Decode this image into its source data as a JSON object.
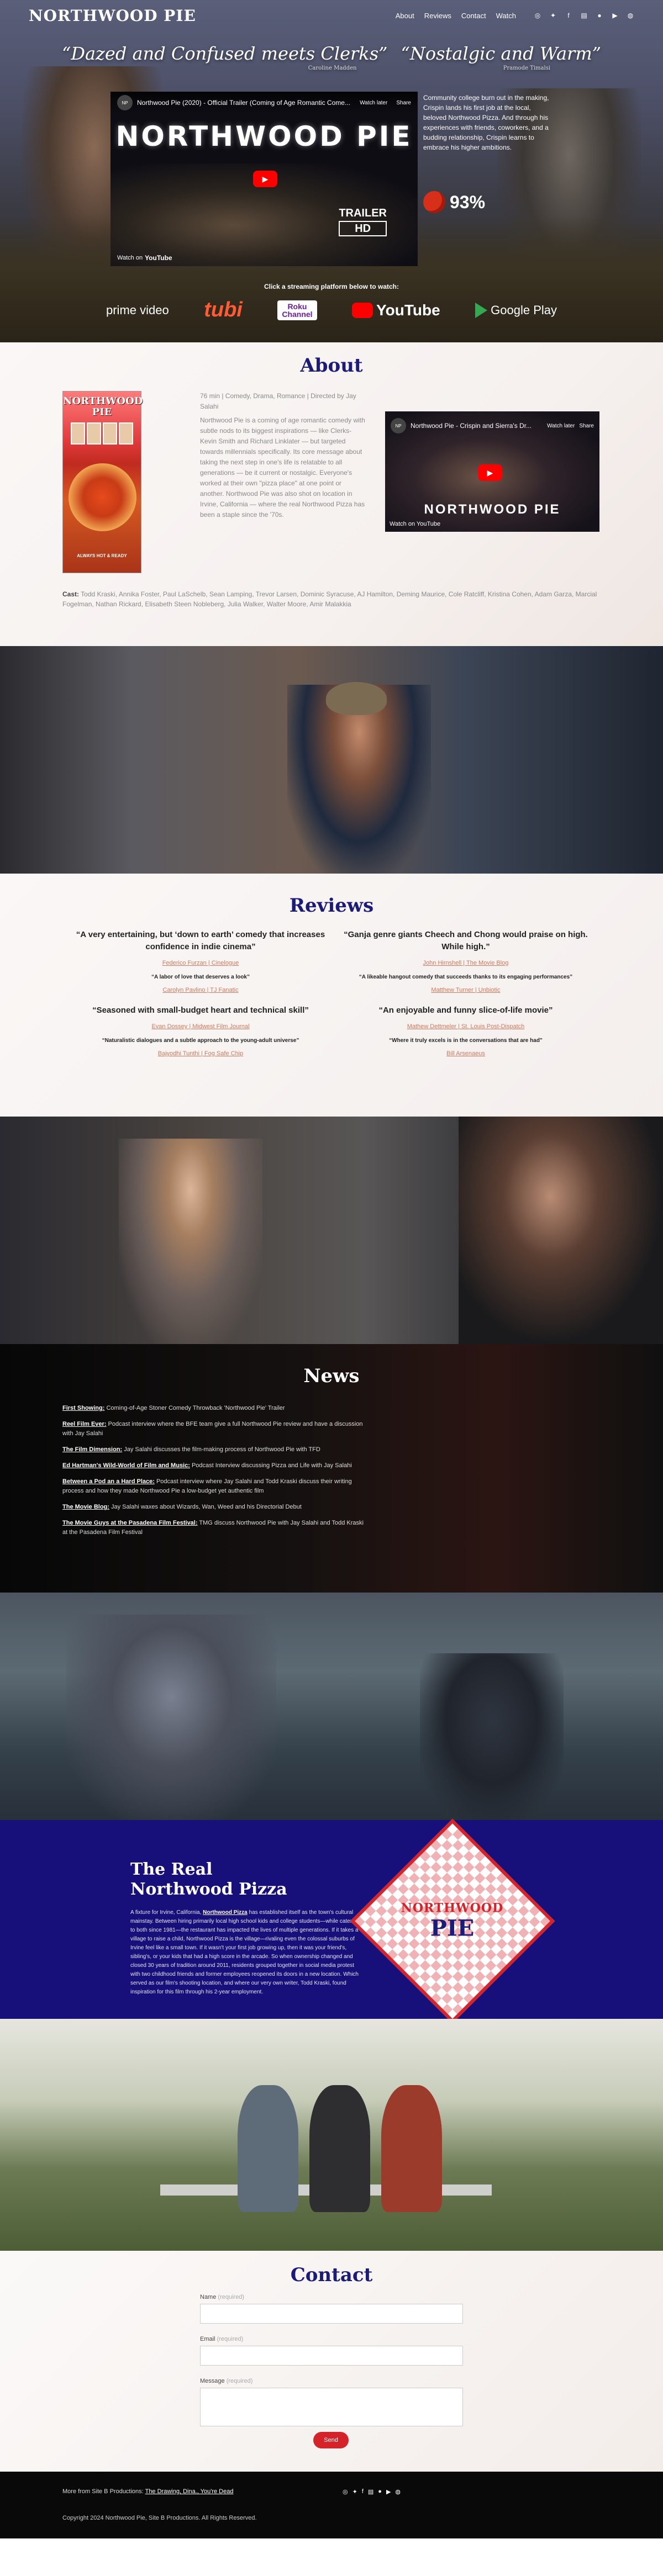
{
  "header": {
    "logo": "NORTHWOOD PIE",
    "nav": [
      "About",
      "Reviews",
      "Contact",
      "Watch"
    ],
    "social_icons": [
      "instagram-icon",
      "twitter-icon",
      "facebook-icon",
      "imdb-icon",
      "letterboxd-icon",
      "youtube-icon",
      "globe-icon"
    ],
    "social_glyphs": [
      "◎",
      "✦",
      "f",
      "▤",
      "●",
      "▶",
      "◍"
    ]
  },
  "hero": {
    "quote1": "“Dazed and Confused meets Clerks”",
    "quote1_source": "Caroline Madden",
    "quote2": "“Nostalgic and Warm”",
    "quote2_source": "Pramode Timalsi",
    "player": {
      "channel": "NP",
      "title": "Northwood Pie (2020) - Official Trailer (Coming of Age Romantic Come...",
      "watch_later": "Watch later",
      "share": "Share",
      "big_title": "NORTHWOOD PIE",
      "trailer": "TRAILER",
      "hd": "HD",
      "watch_on": "Watch on",
      "youtube": "YouTube"
    },
    "synopsis": "Community college burn out in the making, Crispin lands his first job at the local, beloved Northwood Pizza. And through his experiences with friends, coworkers, and a budding relationship, Crispin learns to embrace his higher ambitions.",
    "tomato_score": "93%",
    "stream_label": "Click a streaming platform below to watch:",
    "platforms": {
      "prime": "prime video",
      "tubi": "tubi",
      "roku1": "Roku",
      "roku2": "Channel",
      "youtube": "YouTube",
      "google": "Google Play"
    }
  },
  "about": {
    "heading": "About",
    "poster_title": "NORTHWOOD PIE",
    "poster_tag": "ALWAYS HOT & READY",
    "meta": "76 min | Comedy, Drama, Romance | Directed by Jay Salahi",
    "body": "Northwood Pie is a coming of age romantic comedy with subtle nods to its biggest inspirations — like Clerks-Kevin Smith and Richard Linklater — but targeted towards millennials specifically. Its core message about taking the next step in one's life is relatable to all generations — be it current or nostalgic. Everyone's worked at their own \"pizza place\" at one point or another. Northwood Pie was also shot on location in Irvine, California — where the real Northwood Pizza has been a staple since the '70s.",
    "player": {
      "channel": "NP",
      "title": "Northwood Pie - Crispin and Sierra's Dr...",
      "watch_later": "Watch later",
      "share": "Share",
      "big_title": "NORTHWOOD PIE",
      "watch_on": "Watch on YouTube"
    },
    "cast_label": "Cast:",
    "cast": "Todd Kraski, Annika Foster, Paul LaSchelb, Sean Lamping, Trevor Larsen, Dominic Syracuse, AJ Hamilton, Deming Maurice, Cole Ratcliff, Kristina Cohen, Adam Garza, Marcial Fogelman, Nathan Rickard, Elisabeth Steen Nobleberg, Julia Walker, Walter Moore, Amir Malakkia"
  },
  "reviews": {
    "heading": "Reviews",
    "left": [
      {
        "headline": "“A very entertaining, but ‘down to earth’ comedy that increases confidence in indie cinema”",
        "source": "Federico Furzan | Cinelogue"
      },
      {
        "headline": "“A labor of love that deserves a look”",
        "source": "Carolyn Pavlino | TJ Fanatic",
        "small": true
      },
      {
        "headline": "“Seasoned with small-budget heart and technical skill”",
        "source": "Evan Dossey | Midwest Film Journal"
      },
      {
        "headline": "“Naturalistic dialogues and a subtle approach to the young-adult universe”",
        "source": "Bajyodhi Tunthi | Fog Safe Chip",
        "small": true
      }
    ],
    "right": [
      {
        "headline": "“Ganja genre giants Cheech and Chong would praise on high. While high.”",
        "source": "John Hirnshell | The Movie Blog"
      },
      {
        "headline": "“A likeable hangout comedy that succeeds thanks to its engaging performances”",
        "source": "Matthew Turner | Unbiotic",
        "small": true
      },
      {
        "headline": "“An enjoyable and funny slice-of-life movie”",
        "source": "Mathew Dettmeler | St. Louis Post-Dispatch"
      },
      {
        "headline": "“Where it truly excels is in the conversations that are had”",
        "source": "Bill Arsenaeus",
        "small": true
      }
    ]
  },
  "news": {
    "heading": "News",
    "items": [
      {
        "title": "First Showing:",
        "text": " Coming-of-Age Stoner Comedy Throwback 'Northwood Pie' Trailer"
      },
      {
        "title": "Reel Film Ever:",
        "text": " Podcast interview where the BFE team give a full Northwood Pie review and have a discussion with Jay Salahi"
      },
      {
        "title": "The Film Dimension:",
        "text": " Jay Salahi discusses the film-making process of Northwood Pie with TFD"
      },
      {
        "title": "Ed Hartman's Wild-World of Film and Music:",
        "text": " Podcast Interview discussing Pizza and Life with Jay Salahi"
      },
      {
        "title": "Between a Pod an a Hard Place:",
        "text": " Podcast interview where Jay Salahi and Todd Kraski discuss their writing process and how they made Northwood Pie a low-budget yet authentic film"
      },
      {
        "title": "The Movie Blog:",
        "text": " Jay Salahi waxes about Wizards, Wan, Weed and his Directorial Debut"
      },
      {
        "title": "The Movie Guys at the Pasadena Film Festival:",
        "text": " TMG discuss Northwood Pie with Jay Salahi and Todd Kraski at the Pasadena Film Festival"
      }
    ]
  },
  "real": {
    "heading1": "The Real",
    "heading2": "Northwood Pizza",
    "body_pre": "A fixture for Irvine, California, ",
    "body_link": "Northwood Pizza",
    "body_post": " has established itself as the town's cultural mainstay. Between hiring primarily local high school kids and college students—while catering to both since 1981—the restaurant has impacted the lives of multiple generations. If it takes a village to raise a child, Northwood Pizza is the village—rivaling even the colossal suburbs of Irvine feel like a small town. If it wasn't your first job growing up, then it was your friend's, sibling's, or your kids that had a high score in the arcade. So when ownership changed and closed 30 years of tradition around 2011, residents grouped together in social media protest with two childhood friends and former employees reopened its doors in a new location. Which served as our film's shooting location, and where our very own writer, Todd Kraski, found inspiration for this film through his 2-year employment.",
    "badge_top": "NORTHWOOD",
    "badge_bottom": "PIE"
  },
  "contact": {
    "heading": "Contact",
    "name_label": "Name",
    "email_label": "Email",
    "message_label": "Message",
    "required": "(required)",
    "send": "Send"
  },
  "footer": {
    "more_prefix": "More from Site B Productions: ",
    "more_link": "The Drawing, Dina., You're Dead",
    "social_glyphs": [
      "◎",
      "✦",
      "f",
      "▤",
      "●",
      "▶",
      "◍"
    ],
    "copyright": "Copyright 2024 Northwood Pie, Site B Productions. All Rights Reserved."
  },
  "colors": {
    "accent": "#1b1b7a",
    "brand_red": "#d5232a",
    "link_orange": "#d4785c"
  }
}
